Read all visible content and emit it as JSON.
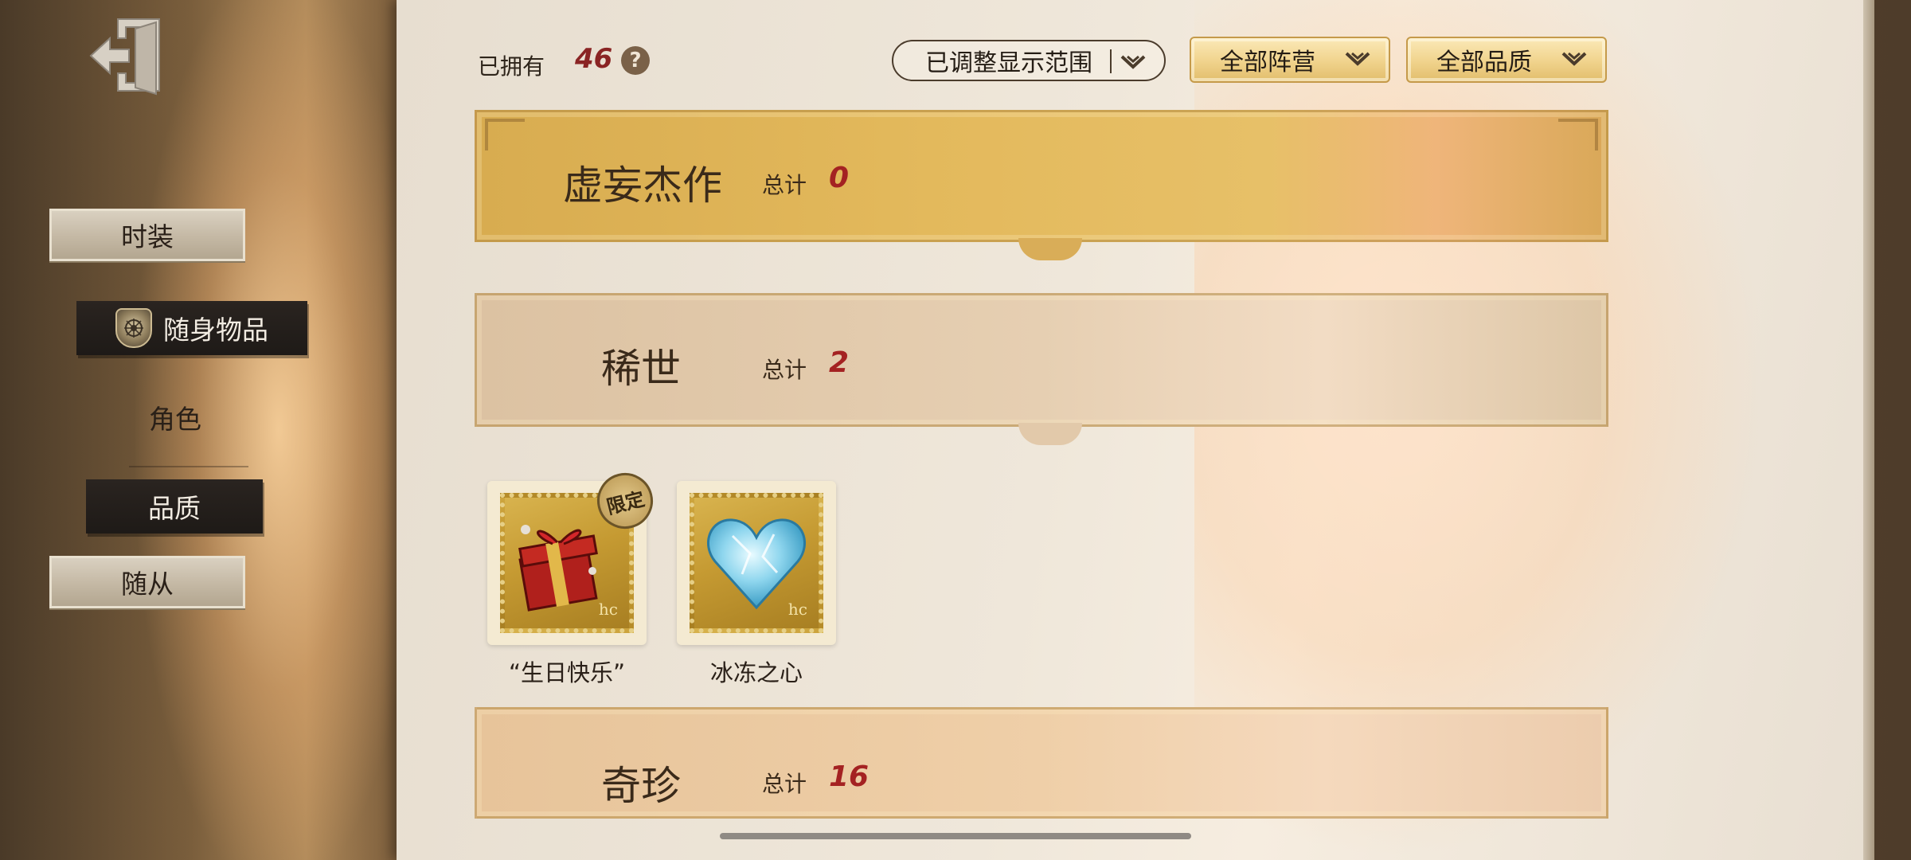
{
  "sidebar": {
    "exit_icon": "exit-door-icon",
    "items": [
      {
        "label": "时装",
        "style": "paper"
      },
      {
        "label": "随身物品",
        "style": "active",
        "icon": "shield-emblem-icon"
      },
      {
        "label": "角色",
        "style": "plain"
      },
      {
        "label": "品质",
        "style": "active-plain"
      },
      {
        "label": "随从",
        "style": "paper"
      }
    ]
  },
  "header": {
    "owned_label": "已拥有",
    "owned_count": "46",
    "help_icon": "question-mark-icon",
    "filters": {
      "display_range": "已调整显示范围",
      "faction": "全部阵营",
      "quality": "全部品质"
    }
  },
  "sections": [
    {
      "title": "虚妄杰作",
      "total_label": "总计",
      "total": "0"
    },
    {
      "title": "稀世",
      "total_label": "总计",
      "total": "2"
    },
    {
      "title": "奇珍",
      "total_label": "总计",
      "total": "16"
    }
  ],
  "items": [
    {
      "name": "“生日快乐”",
      "badge": "限定",
      "icon": "gift-box-icon"
    },
    {
      "name": "冰冻之心",
      "icon": "ice-heart-icon"
    }
  ],
  "colors": {
    "count_red": "#8a2424",
    "gold_band": "#e3b95c",
    "active_nav": "#1e1a17"
  }
}
